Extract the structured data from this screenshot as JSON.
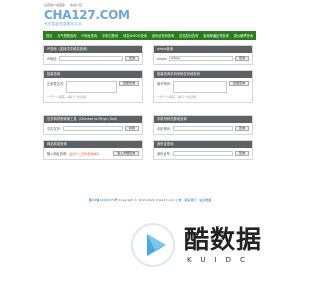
{
  "topbar": {
    "left": "设置客户收藏库",
    "right": "本站介绍"
  },
  "logo": {
    "main": "CHA127.COM",
    "sub": "专业智能信息服务平台"
  },
  "nav": [
    "首页",
    "天气预报查询",
    "IP地址查询",
    "手机归属地",
    "域名WHOIS查询",
    "身份证号码查询",
    "姓名配对查询",
    "各地邮编区号查询",
    "周公解梦查询",
    "代码转换工具"
  ],
  "panels": {
    "ip": {
      "title": "IP查询（支持中文域名查询）",
      "label": "IP地址:",
      "value": "",
      "button": "查询"
    },
    "whois": {
      "title": "whois查询",
      "label": "whois:",
      "value": "whois",
      "button": "查询"
    },
    "convert": {
      "title": "批量查询",
      "label": "正则表达式:",
      "button": "批量查询",
      "hint": "一行一个填写，每行一条记录"
    },
    "phone": {
      "title": "批量查询手机号码在何地查询",
      "label": "填写号码:",
      "button": "批量查询",
      "hint": "一行一个填写，每行一条记录"
    },
    "pinyin": {
      "title": "汉字转拼音转换工具（Chinese to Pinyin Tool）",
      "label": "中文汉字:",
      "button": "转换"
    },
    "mobile": {
      "title": "手机号码归属地查询",
      "label": "手机号码:",
      "button": "查询"
    },
    "zodiac": {
      "title": "网站收录查询",
      "label": "输入网址查询:",
      "note": "最近十二月内查询排序",
      "button": "进入详细查询"
    },
    "postcode": {
      "title": "身份证查询",
      "label": "身份证号:",
      "button": "查询"
    }
  },
  "footer": {
    "line1": "蜀ICP备12003372号",
    "line2": "Copyright © 2013-2021 Cha127.com",
    "links": "公告 · 联系我们 · 站点地图"
  },
  "watermark": {
    "cn": "酷数据",
    "en": "KUIDC"
  }
}
